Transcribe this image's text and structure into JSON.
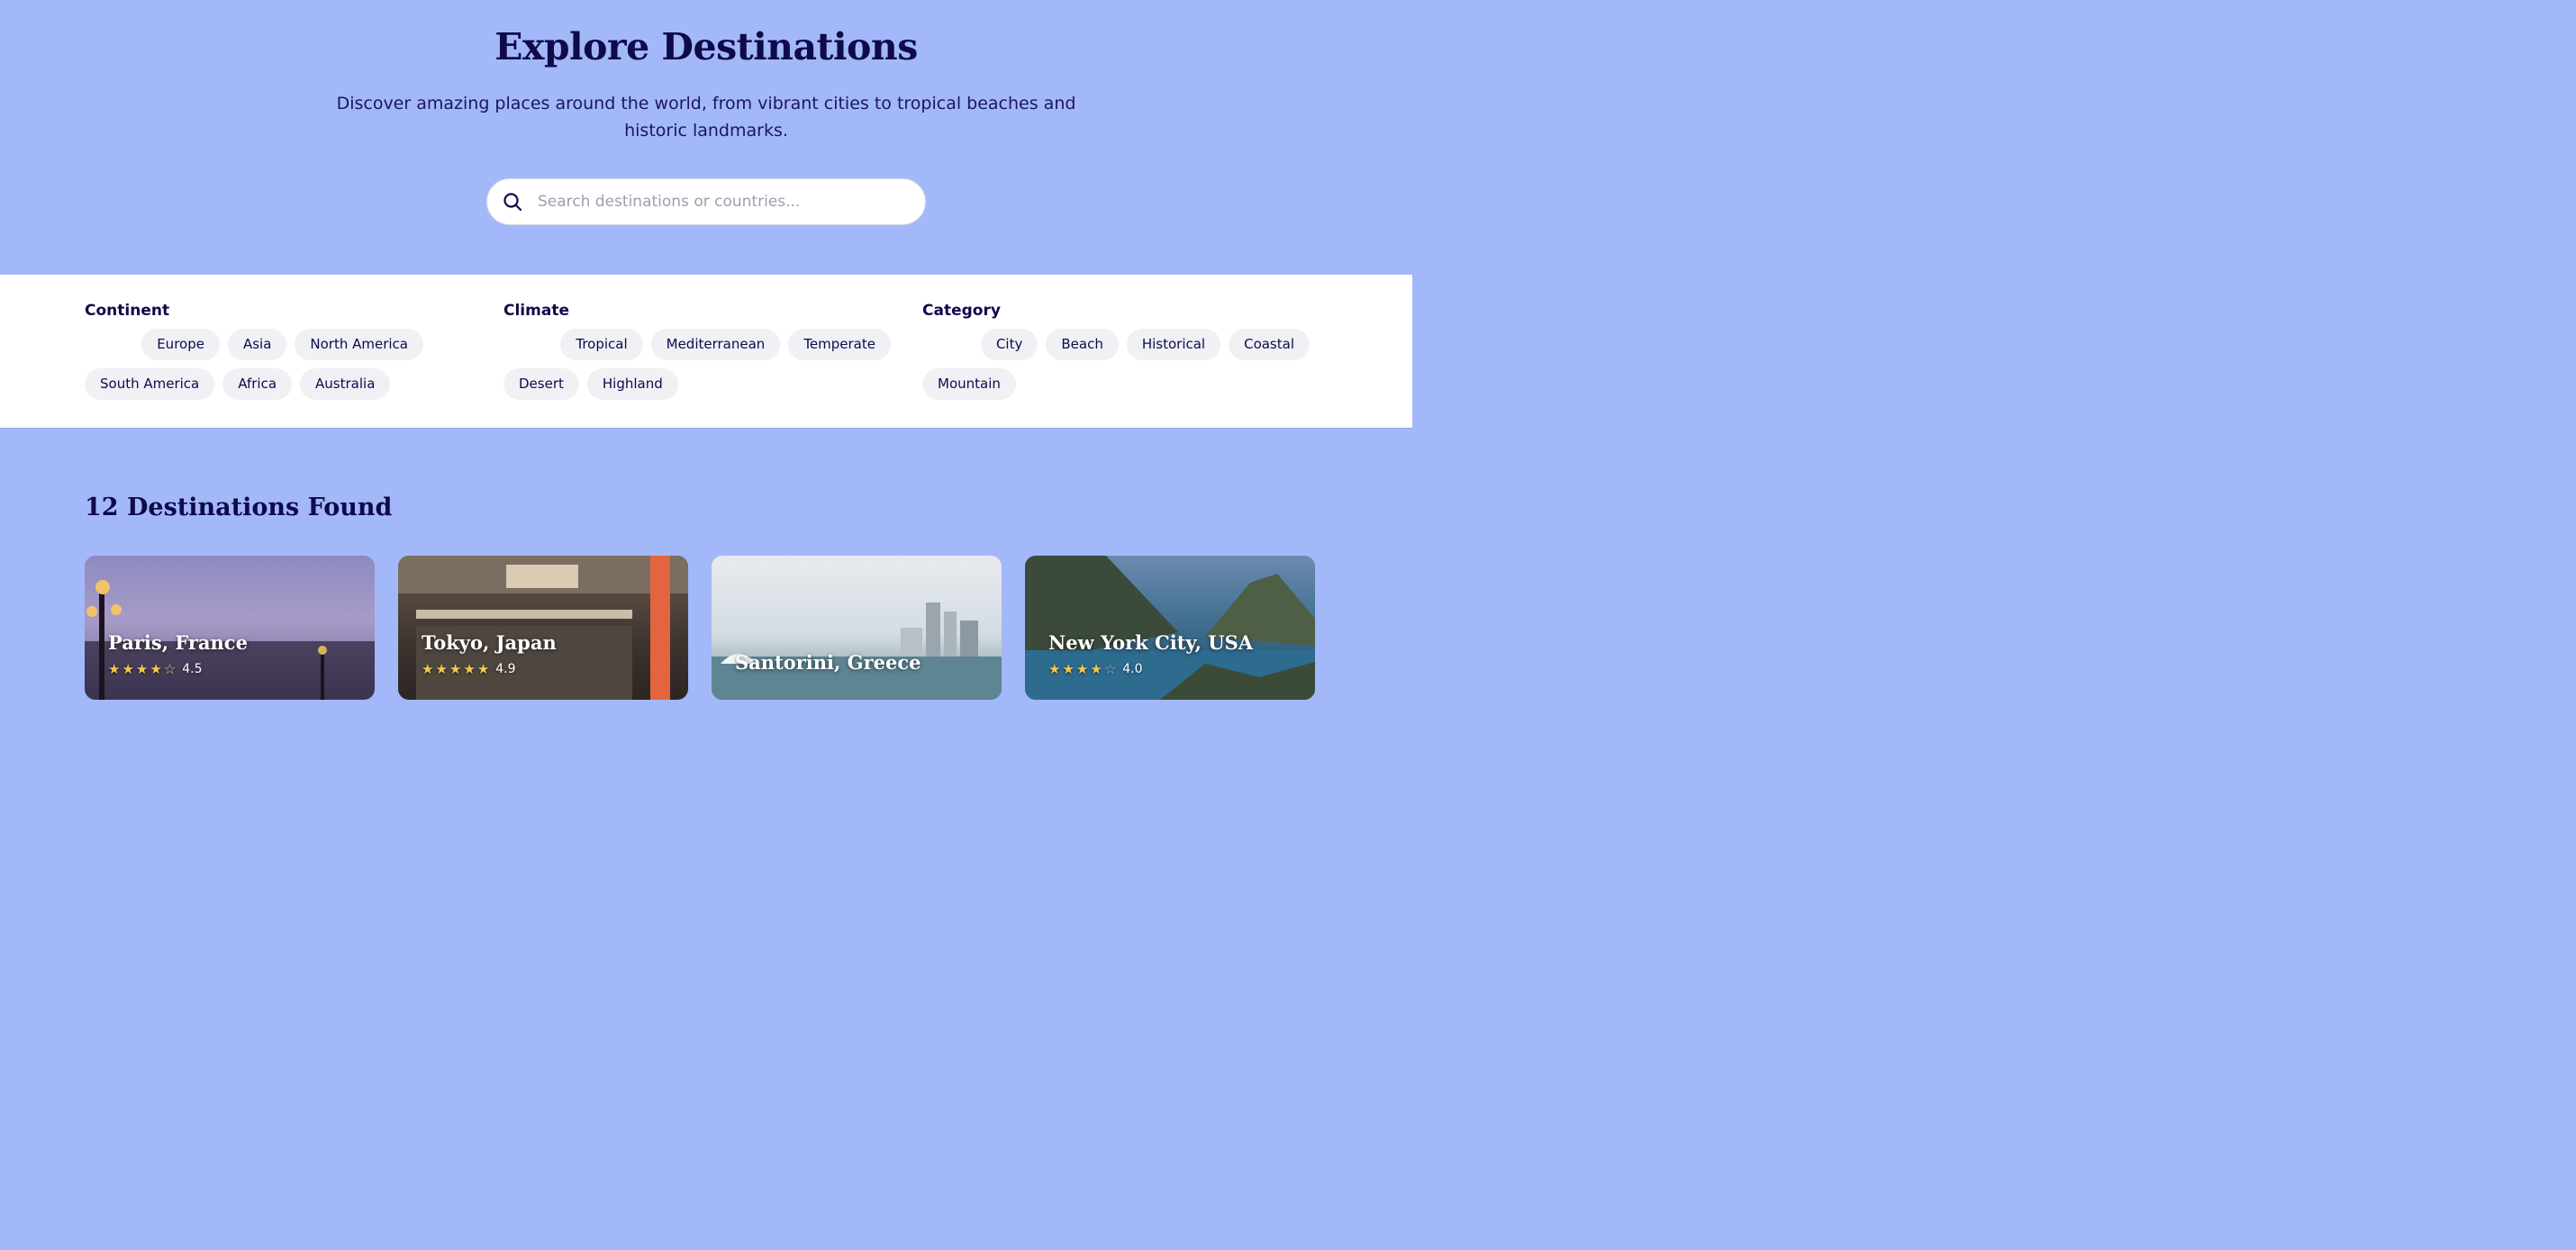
{
  "hero": {
    "title": "Explore Destinations",
    "subtitle": "Discover amazing places around the world, from vibrant cities to tropical beaches and historic landmarks.",
    "search_placeholder": "Search destinations or countries..."
  },
  "filters": {
    "continent": {
      "label": "Continent",
      "options": [
        "Europe",
        "Asia",
        "North America",
        "South America",
        "Africa",
        "Australia"
      ]
    },
    "climate": {
      "label": "Climate",
      "options": [
        "Tropical",
        "Mediterranean",
        "Temperate",
        "Desert",
        "Highland"
      ]
    },
    "category": {
      "label": "Category",
      "options": [
        "City",
        "Beach",
        "Historical",
        "Coastal",
        "Mountain"
      ]
    }
  },
  "results": {
    "title": "12 Destinations Found"
  },
  "cards": [
    {
      "name": "Paris, France",
      "rating": 4.5,
      "rating_label": "4.5"
    },
    {
      "name": "Tokyo, Japan",
      "rating": 4.9,
      "rating_label": "4.9"
    },
    {
      "name": "Santorini, Greece",
      "rating": null,
      "rating_label": ""
    },
    {
      "name": "New York City, USA",
      "rating": 4.0,
      "rating_label": "4.0"
    }
  ],
  "colors": {
    "background": "#a3b8f8",
    "text": "#0f0a4a",
    "chip": "#f0f1f5",
    "star": "#f7c948"
  }
}
